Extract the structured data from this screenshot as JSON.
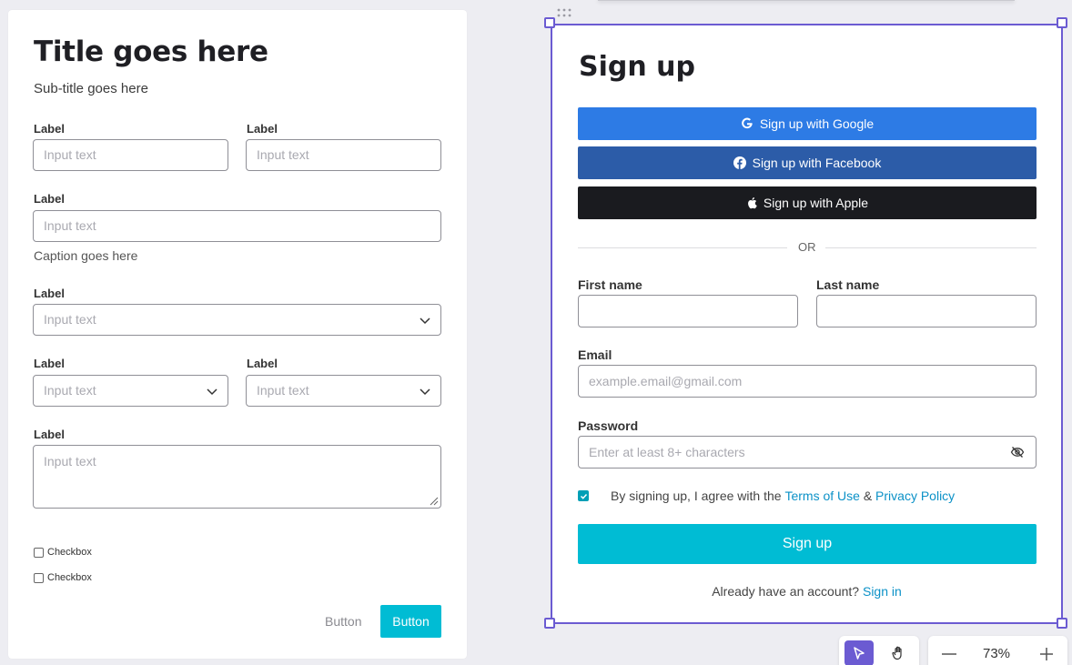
{
  "form": {
    "title": "Title goes here",
    "subtitle": "Sub-title goes here",
    "label": "Label",
    "placeholder": "Input text",
    "caption": "Caption goes here",
    "checkbox_label": "Checkbox",
    "secondary_button": "Button",
    "primary_button": "Button"
  },
  "signup": {
    "title": "Sign up",
    "google": "Sign up with Google",
    "facebook": "Sign up with Facebook",
    "apple": "Sign up with Apple",
    "or": "OR",
    "first_name": "First name",
    "last_name": "Last name",
    "email_label": "Email",
    "email_placeholder": "example.email@gmail.com",
    "password_label": "Password",
    "password_placeholder": "Enter at least 8+ characters",
    "agree_prefix": "By signing up, I agree with the",
    "terms": "Terms of Use",
    "amp": "&",
    "privacy": "Privacy Policy",
    "button": "Sign up",
    "already": "Already have an account?",
    "signin": "Sign in",
    "agree_checked": true
  },
  "toolbar": {
    "zoom": "73%"
  },
  "colors": {
    "accent": "#00bcd4",
    "selection": "#6b5bd2",
    "google": "#2d7be5",
    "facebook": "#2c5ca8",
    "apple": "#1a1b1f"
  }
}
